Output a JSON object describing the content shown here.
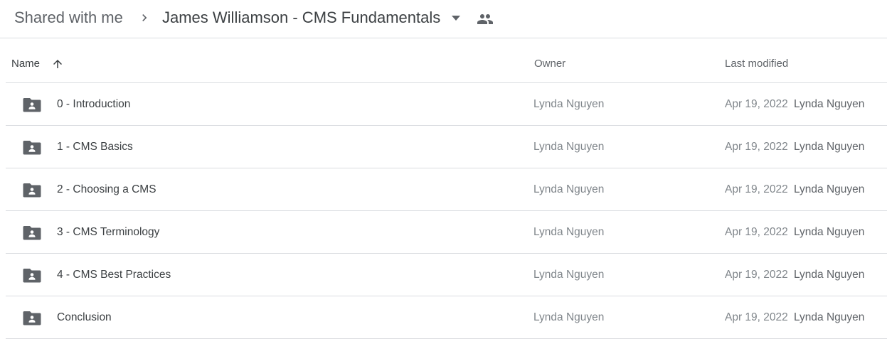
{
  "breadcrumb": {
    "root": "Shared with me",
    "current": "James Williamson - CMS Fundamentals"
  },
  "columns": {
    "name": "Name",
    "owner": "Owner",
    "last_modified": "Last modified",
    "sort_direction": "ascending"
  },
  "rows": [
    {
      "name": "0 - Introduction",
      "owner": "Lynda Nguyen",
      "date": "Apr 19, 2022",
      "modifier": "Lynda Nguyen"
    },
    {
      "name": "1 - CMS Basics",
      "owner": "Lynda Nguyen",
      "date": "Apr 19, 2022",
      "modifier": "Lynda Nguyen"
    },
    {
      "name": "2 - Choosing a CMS",
      "owner": "Lynda Nguyen",
      "date": "Apr 19, 2022",
      "modifier": "Lynda Nguyen"
    },
    {
      "name": "3 - CMS Terminology",
      "owner": "Lynda Nguyen",
      "date": "Apr 19, 2022",
      "modifier": "Lynda Nguyen"
    },
    {
      "name": "4 - CMS Best Practices",
      "owner": "Lynda Nguyen",
      "date": "Apr 19, 2022",
      "modifier": "Lynda Nguyen"
    },
    {
      "name": "Conclusion",
      "owner": "Lynda Nguyen",
      "date": "Apr 19, 2022",
      "modifier": "Lynda Nguyen"
    }
  ],
  "icons": {
    "separator": "chevron-right-icon",
    "dropdown": "arrow-drop-down-icon",
    "shared": "people-icon",
    "sort": "arrow-up-icon",
    "folder": "shared-folder-icon"
  },
  "colors": {
    "icon": "#5f6368",
    "divider": "#dadce0"
  }
}
